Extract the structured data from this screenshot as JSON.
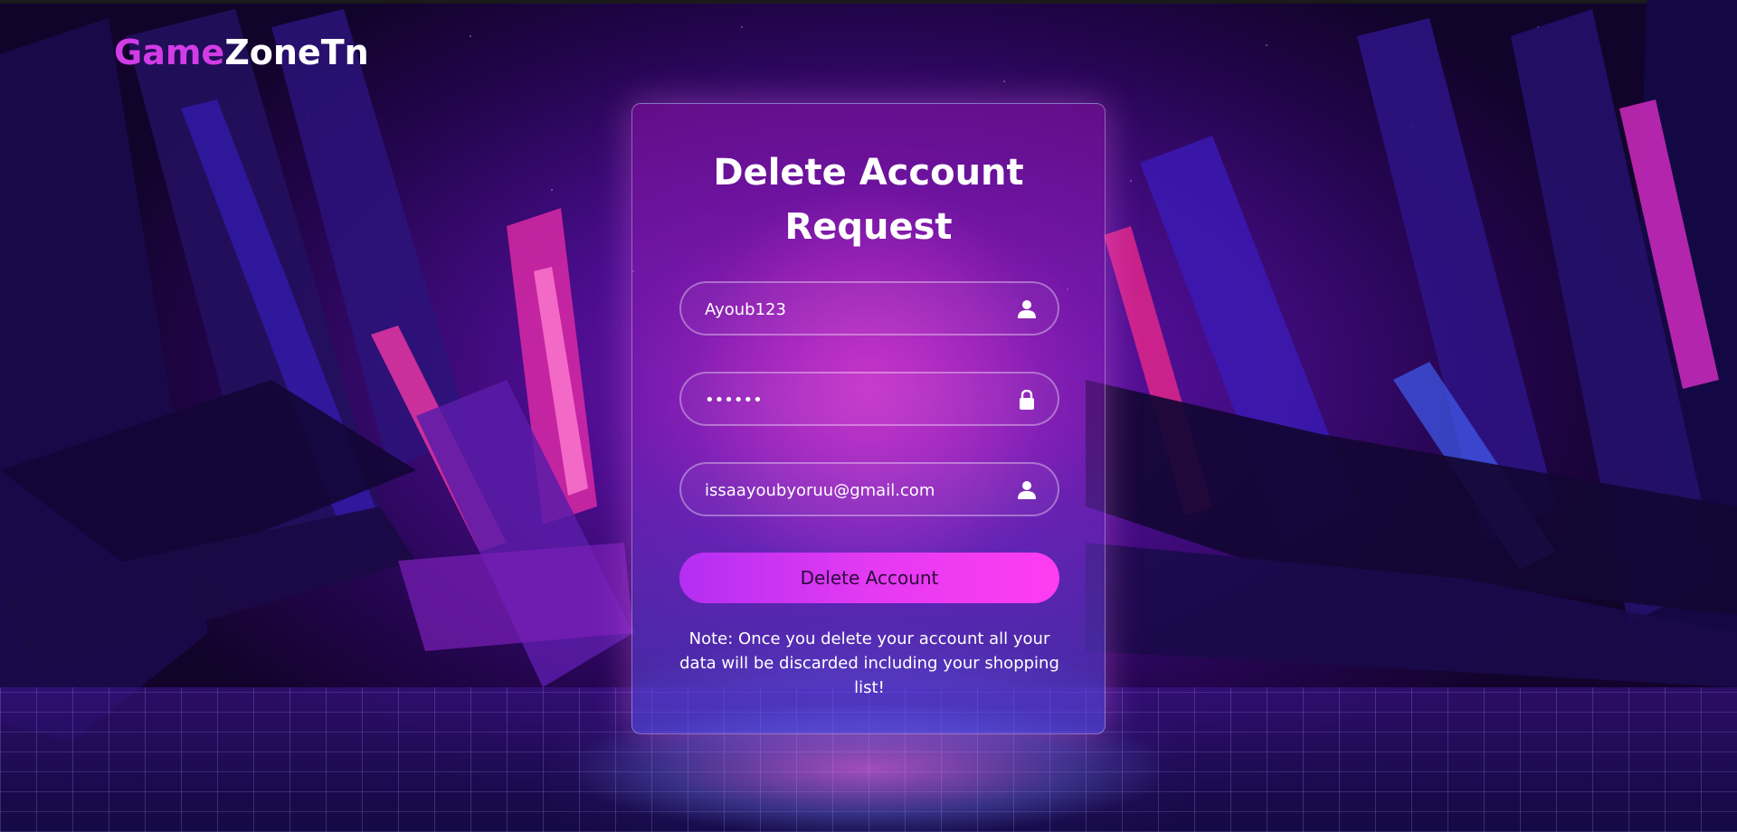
{
  "brand": {
    "part1": "Game",
    "part2": "ZoneTn"
  },
  "form": {
    "title_line1": "Delete Account",
    "title_line2": "Request",
    "username_value": "Ayoub123",
    "password_value": "••••••",
    "email_value": "issaayoubyoruu@gmail.com",
    "submit_label": "Delete Account",
    "note": "Note: Once you delete your account all your data will be discarded including your shopping list!"
  },
  "icons": {
    "username": "user-icon",
    "password": "lock-icon",
    "email": "user-icon"
  },
  "colors": {
    "brand_accent": "#d23ce6",
    "button_gradient_start": "#b42ef2",
    "button_gradient_end": "#ff3cf0"
  }
}
